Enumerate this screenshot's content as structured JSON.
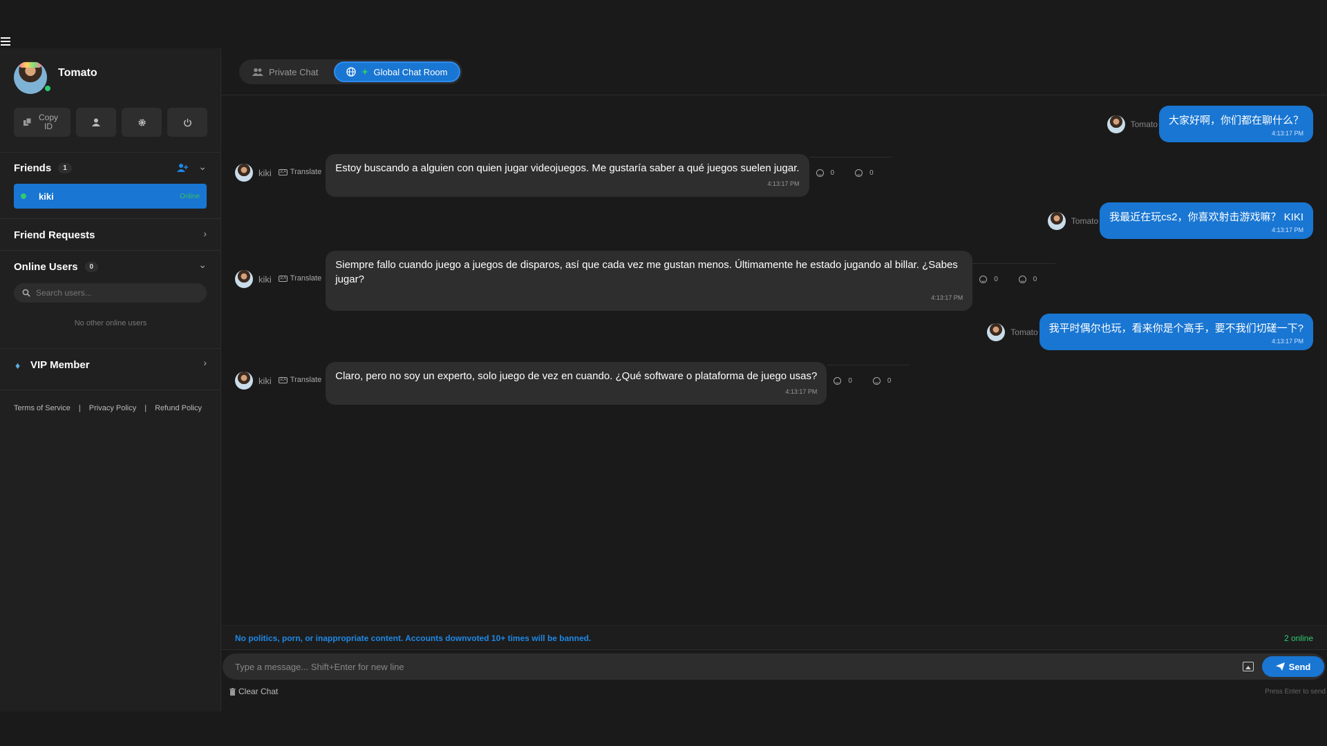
{
  "profile": {
    "name": "Tomato",
    "copy_label": "Copy ID"
  },
  "friends": {
    "title": "Friends",
    "count": "1",
    "items": [
      {
        "name": "kiki",
        "status": "Online"
      }
    ]
  },
  "friend_requests": {
    "title": "Friend Requests"
  },
  "online_users": {
    "title": "Online Users",
    "count": "0",
    "search_placeholder": "Search users...",
    "empty": "No other online users"
  },
  "vip": {
    "title": "VIP Member"
  },
  "footer": {
    "terms": "Terms of Service",
    "sep": "|",
    "privacy": "Privacy Policy",
    "refund": "Refund Policy"
  },
  "tabs": {
    "private": "Private Chat",
    "global": "Global Chat Room"
  },
  "messages": [
    {
      "sender": "Tomato",
      "text": "大家好啊，你们都在聊什么？",
      "time": "4:13:17 PM",
      "own": true
    },
    {
      "sender": "kiki",
      "translate": "Translate",
      "text": "Estoy buscando a alguien con quien jugar videojuegos. Me gustaría saber a qué juegos suelen jugar.",
      "time": "4:13:17 PM",
      "up": "0",
      "down": "0"
    },
    {
      "sender": "Tomato",
      "text": "我最近在玩cs2，你喜欢射击游戏嘛？ KIKI",
      "time": "4:13:17 PM",
      "own": true
    },
    {
      "sender": "kiki",
      "translate": "Translate",
      "text": "Siempre fallo cuando juego a juegos de disparos, así que cada vez me gustan menos. Últimamente he estado jugando al billar. ¿Sabes jugar?",
      "time": "4:13:17 PM",
      "up": "0",
      "down": "0"
    },
    {
      "sender": "Tomato",
      "text": "我平时偶尔也玩，看来你是个高手，要不我们切磋一下?",
      "time": "4:13:17 PM",
      "own": true
    },
    {
      "sender": "kiki",
      "translate": "Translate",
      "text": "Claro, pero no soy un experto, solo juego de vez en cuando. ¿Qué software o plataforma de juego usas?",
      "time": "4:13:17 PM",
      "up": "0",
      "down": "0"
    }
  ],
  "rules": "No politics, porn, or inappropriate content. Accounts downvoted 10+ times will be banned.",
  "online_count": "2 online",
  "composer": {
    "placeholder": "Type a message... Shift+Enter for new line",
    "send": "Send",
    "clear": "Clear Chat",
    "hint": "Press Enter to send"
  },
  "colors": {
    "accent": "#1976d2",
    "online": "#2ecc71",
    "background": "#1a1a1a",
    "sidebar": "#202020",
    "bubble_in": "#2e2e2e"
  }
}
